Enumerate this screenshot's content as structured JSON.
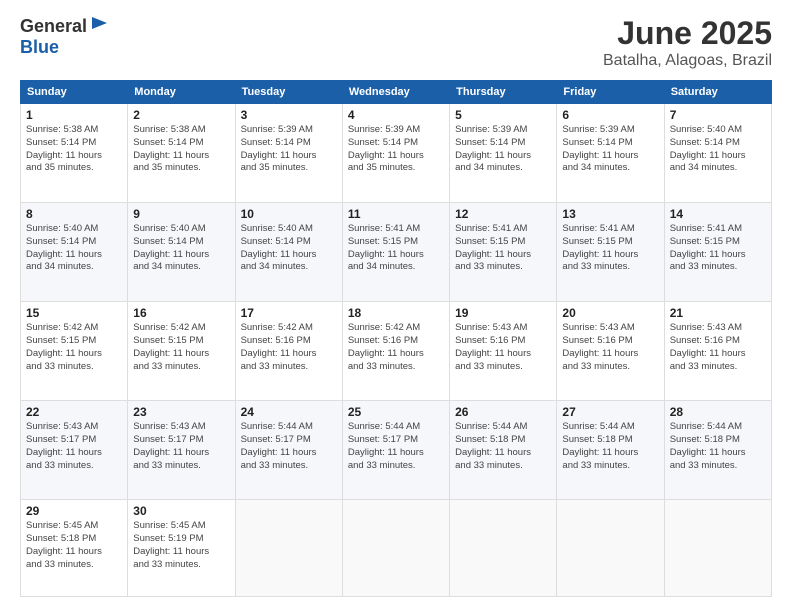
{
  "header": {
    "logo_line1": "General",
    "logo_line2": "Blue",
    "month": "June 2025",
    "location": "Batalha, Alagoas, Brazil"
  },
  "days_of_week": [
    "Sunday",
    "Monday",
    "Tuesday",
    "Wednesday",
    "Thursday",
    "Friday",
    "Saturday"
  ],
  "weeks": [
    [
      {
        "day": "1",
        "info": "Sunrise: 5:38 AM\nSunset: 5:14 PM\nDaylight: 11 hours\nand 35 minutes."
      },
      {
        "day": "2",
        "info": "Sunrise: 5:38 AM\nSunset: 5:14 PM\nDaylight: 11 hours\nand 35 minutes."
      },
      {
        "day": "3",
        "info": "Sunrise: 5:39 AM\nSunset: 5:14 PM\nDaylight: 11 hours\nand 35 minutes."
      },
      {
        "day": "4",
        "info": "Sunrise: 5:39 AM\nSunset: 5:14 PM\nDaylight: 11 hours\nand 35 minutes."
      },
      {
        "day": "5",
        "info": "Sunrise: 5:39 AM\nSunset: 5:14 PM\nDaylight: 11 hours\nand 34 minutes."
      },
      {
        "day": "6",
        "info": "Sunrise: 5:39 AM\nSunset: 5:14 PM\nDaylight: 11 hours\nand 34 minutes."
      },
      {
        "day": "7",
        "info": "Sunrise: 5:40 AM\nSunset: 5:14 PM\nDaylight: 11 hours\nand 34 minutes."
      }
    ],
    [
      {
        "day": "8",
        "info": "Sunrise: 5:40 AM\nSunset: 5:14 PM\nDaylight: 11 hours\nand 34 minutes."
      },
      {
        "day": "9",
        "info": "Sunrise: 5:40 AM\nSunset: 5:14 PM\nDaylight: 11 hours\nand 34 minutes."
      },
      {
        "day": "10",
        "info": "Sunrise: 5:40 AM\nSunset: 5:14 PM\nDaylight: 11 hours\nand 34 minutes."
      },
      {
        "day": "11",
        "info": "Sunrise: 5:41 AM\nSunset: 5:15 PM\nDaylight: 11 hours\nand 34 minutes."
      },
      {
        "day": "12",
        "info": "Sunrise: 5:41 AM\nSunset: 5:15 PM\nDaylight: 11 hours\nand 33 minutes."
      },
      {
        "day": "13",
        "info": "Sunrise: 5:41 AM\nSunset: 5:15 PM\nDaylight: 11 hours\nand 33 minutes."
      },
      {
        "day": "14",
        "info": "Sunrise: 5:41 AM\nSunset: 5:15 PM\nDaylight: 11 hours\nand 33 minutes."
      }
    ],
    [
      {
        "day": "15",
        "info": "Sunrise: 5:42 AM\nSunset: 5:15 PM\nDaylight: 11 hours\nand 33 minutes."
      },
      {
        "day": "16",
        "info": "Sunrise: 5:42 AM\nSunset: 5:15 PM\nDaylight: 11 hours\nand 33 minutes."
      },
      {
        "day": "17",
        "info": "Sunrise: 5:42 AM\nSunset: 5:16 PM\nDaylight: 11 hours\nand 33 minutes."
      },
      {
        "day": "18",
        "info": "Sunrise: 5:42 AM\nSunset: 5:16 PM\nDaylight: 11 hours\nand 33 minutes."
      },
      {
        "day": "19",
        "info": "Sunrise: 5:43 AM\nSunset: 5:16 PM\nDaylight: 11 hours\nand 33 minutes."
      },
      {
        "day": "20",
        "info": "Sunrise: 5:43 AM\nSunset: 5:16 PM\nDaylight: 11 hours\nand 33 minutes."
      },
      {
        "day": "21",
        "info": "Sunrise: 5:43 AM\nSunset: 5:16 PM\nDaylight: 11 hours\nand 33 minutes."
      }
    ],
    [
      {
        "day": "22",
        "info": "Sunrise: 5:43 AM\nSunset: 5:17 PM\nDaylight: 11 hours\nand 33 minutes."
      },
      {
        "day": "23",
        "info": "Sunrise: 5:43 AM\nSunset: 5:17 PM\nDaylight: 11 hours\nand 33 minutes."
      },
      {
        "day": "24",
        "info": "Sunrise: 5:44 AM\nSunset: 5:17 PM\nDaylight: 11 hours\nand 33 minutes."
      },
      {
        "day": "25",
        "info": "Sunrise: 5:44 AM\nSunset: 5:17 PM\nDaylight: 11 hours\nand 33 minutes."
      },
      {
        "day": "26",
        "info": "Sunrise: 5:44 AM\nSunset: 5:18 PM\nDaylight: 11 hours\nand 33 minutes."
      },
      {
        "day": "27",
        "info": "Sunrise: 5:44 AM\nSunset: 5:18 PM\nDaylight: 11 hours\nand 33 minutes."
      },
      {
        "day": "28",
        "info": "Sunrise: 5:44 AM\nSunset: 5:18 PM\nDaylight: 11 hours\nand 33 minutes."
      }
    ],
    [
      {
        "day": "29",
        "info": "Sunrise: 5:45 AM\nSunset: 5:18 PM\nDaylight: 11 hours\nand 33 minutes."
      },
      {
        "day": "30",
        "info": "Sunrise: 5:45 AM\nSunset: 5:19 PM\nDaylight: 11 hours\nand 33 minutes."
      },
      {
        "day": "",
        "info": ""
      },
      {
        "day": "",
        "info": ""
      },
      {
        "day": "",
        "info": ""
      },
      {
        "day": "",
        "info": ""
      },
      {
        "day": "",
        "info": ""
      }
    ]
  ]
}
